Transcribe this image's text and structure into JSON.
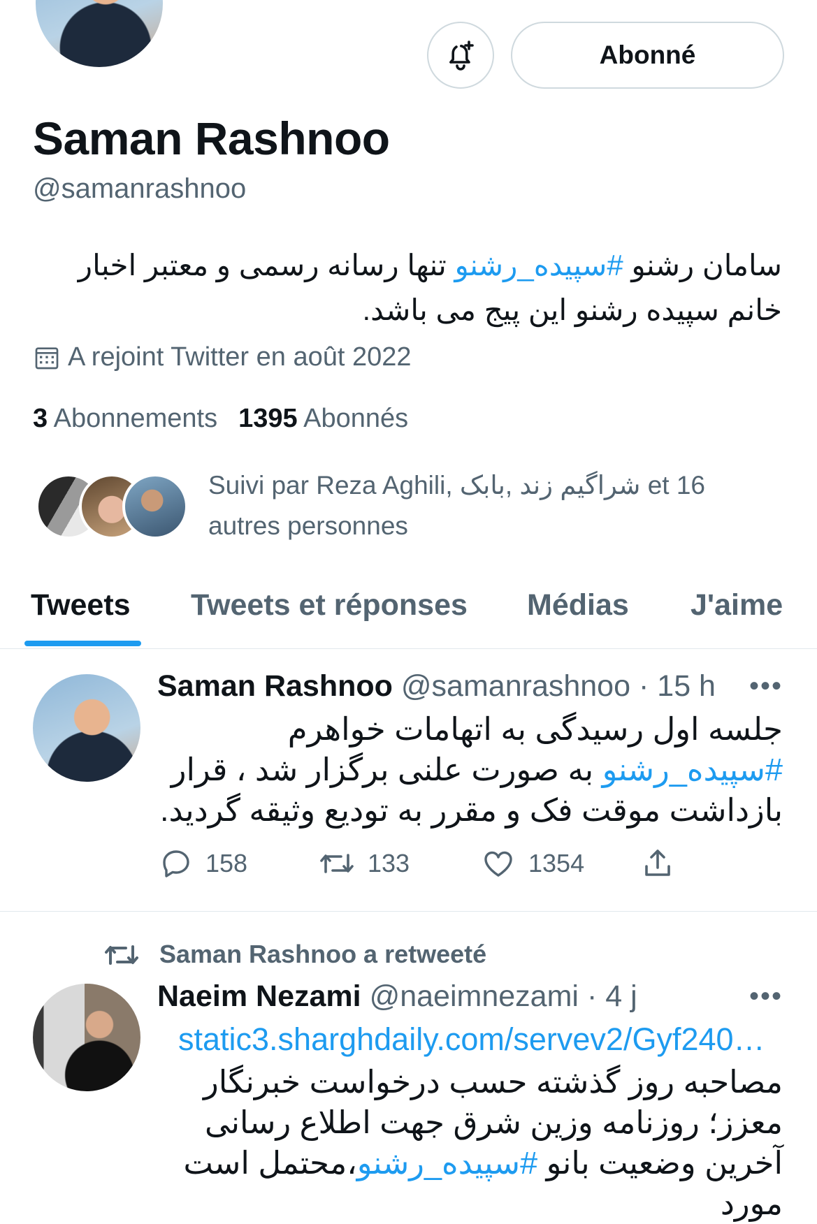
{
  "profile": {
    "name": "Saman Rashnoo",
    "handle": "@samanrashnoo",
    "bio_part1": "سامان رشنو ",
    "bio_hashtag": "#سپیده_رشنو",
    "bio_part2": " تنها رسانه رسمی و معتبر اخبار خانم سپیده رشنو این پیج می باشد.",
    "joined": "A rejoint Twitter en août 2022",
    "following_count": "3",
    "following_label": "Abonnements",
    "followers_count": "1395",
    "followers_label": "Abonnés",
    "followed_by": "Suivi par Reza Aghili, شراگیم زند ,بابک et 16 autres personnes"
  },
  "buttons": {
    "follow_label": "Abonné",
    "notify_icon": "bell-plus-icon"
  },
  "tabs": [
    {
      "label": "Tweets",
      "active": true
    },
    {
      "label": "Tweets et réponses",
      "active": false
    },
    {
      "label": "Médias",
      "active": false
    },
    {
      "label": "J'aime",
      "active": false
    }
  ],
  "tweets": [
    {
      "author": "Saman Rashnoo",
      "handle": "@samanrashnoo",
      "time": "· 15 h",
      "more": "•••",
      "text_part1": "جلسه اول رسیدگی به اتهامات خواهرم ",
      "hashtag": "#سپیده_رشنو",
      "text_part2": " به صورت علنی برگزار شد ، قرار بازداشت موقت فک و مقرر به تودیع وثیقه گردید.",
      "replies": "158",
      "retweets": "133",
      "likes": "1354"
    },
    {
      "retweet_label": "Saman Rashnoo a retweeté",
      "author": "Naeim Nezami",
      "handle": "@naeimnezami",
      "time": "· 4 j",
      "more": "•••",
      "link": "static3.sharghdaily.com/servev2/Gyf240…",
      "text_part1": "مصاحبه روز گذشته حسب درخواست خبرنگار معزز؛ روزنامه وزین شرق جهت اطلاع رسانی آخرین وضعیت بانو ",
      "hashtag": "#سپیده_رشنو",
      "text_part2": "،محتمل است مورد"
    }
  ],
  "colors": {
    "accent": "#1d9bf0",
    "text": "#0f1419",
    "secondary": "#536471",
    "border": "#cfd9de"
  }
}
